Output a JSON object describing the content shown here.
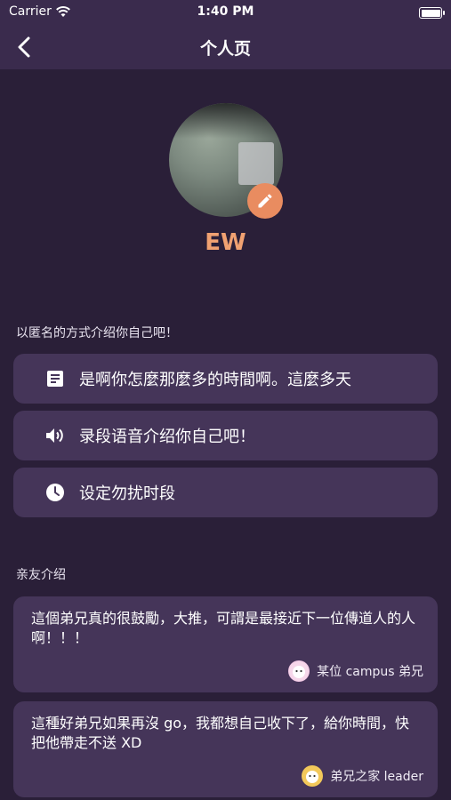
{
  "status": {
    "carrier": "Carrier",
    "time": "1:40 PM"
  },
  "nav": {
    "title": "个人页"
  },
  "profile": {
    "name": "EW"
  },
  "intro": {
    "label": "以匿名的方式介绍你自己吧！",
    "items": [
      {
        "icon": "note-icon",
        "label": "是啊你怎麼那麼多的時間啊。這麼多天"
      },
      {
        "icon": "speaker-icon",
        "label": "录段语音介绍你自己吧！"
      },
      {
        "icon": "clock-icon",
        "label": "设定勿扰时段"
      }
    ]
  },
  "friends": {
    "label": "亲友介绍",
    "items": [
      {
        "text": "這個弟兄真的很鼓勵，大推，可謂是最接近下一位傳道人的人啊！！！",
        "author": "某位 campus 弟兄"
      },
      {
        "text": "這種好弟兄如果再沒 go，我都想自己收下了，給你時間，快把他帶走不送 XD",
        "author": "弟兄之家 leader"
      }
    ]
  },
  "colors": {
    "accent": "#e98c60",
    "card": "#453559",
    "background": "#2a1f38"
  }
}
